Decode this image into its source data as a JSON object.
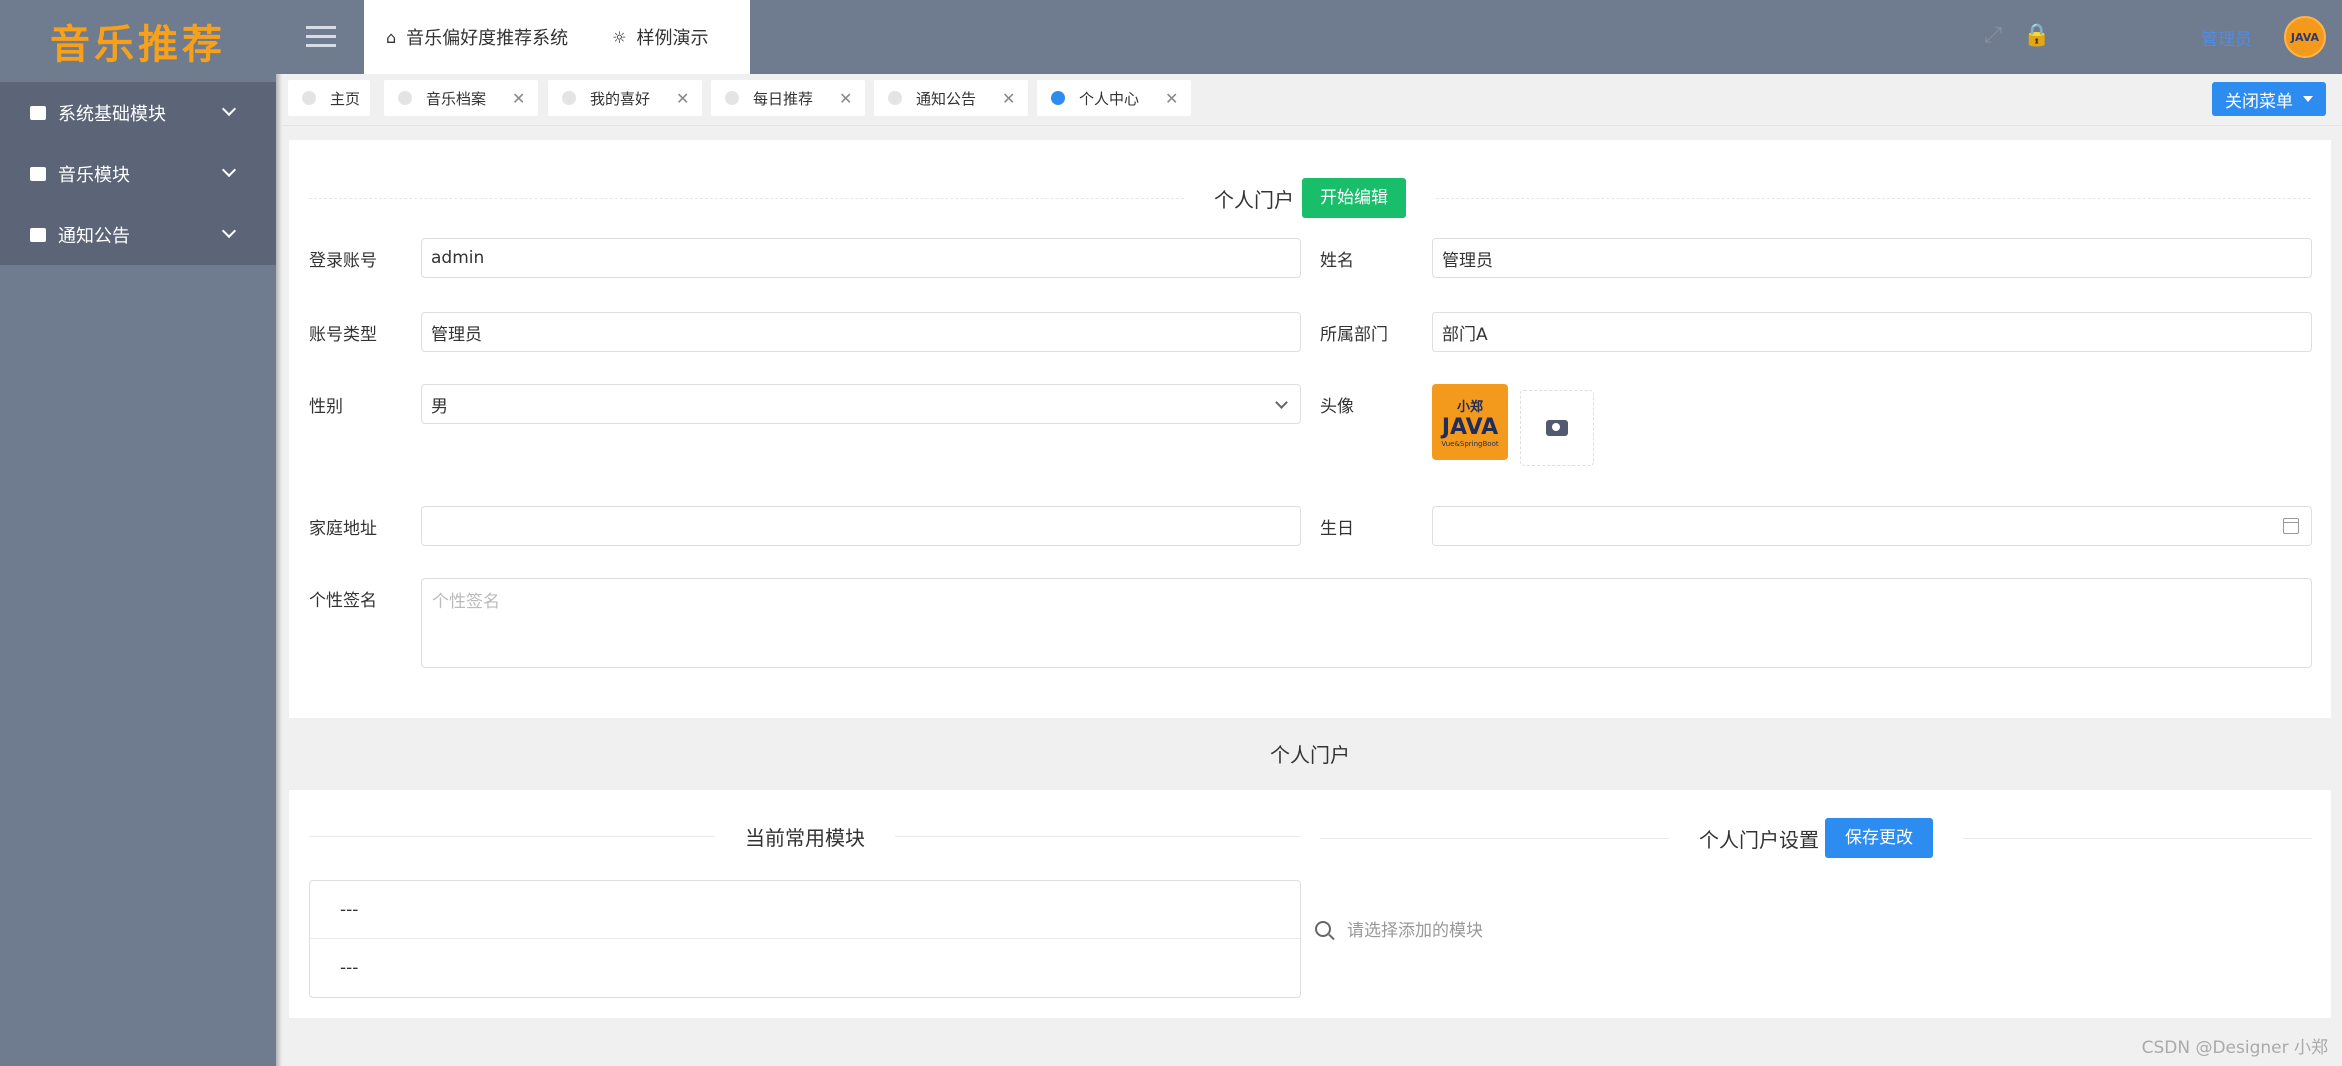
{
  "app": {
    "logo": "音乐推荐"
  },
  "sidebar": {
    "items": [
      {
        "label": "系统基础模块",
        "icon": "chart-icon"
      },
      {
        "label": "音乐模块",
        "icon": "cup-icon"
      },
      {
        "label": "通知公告",
        "icon": "notice-icon"
      }
    ]
  },
  "header": {
    "tabs": [
      {
        "label": "音乐偏好度推荐系统",
        "icon": "home-icon"
      },
      {
        "label": "样例演示",
        "icon": "bulb-icon"
      }
    ],
    "user_name": "管理员",
    "avatar_text": "JAVA"
  },
  "tabbar": {
    "tabs": [
      {
        "label": "主页",
        "active": false,
        "closable": false
      },
      {
        "label": "音乐档案",
        "active": false,
        "closable": true
      },
      {
        "label": "我的喜好",
        "active": false,
        "closable": true
      },
      {
        "label": "每日推荐",
        "active": false,
        "closable": true
      },
      {
        "label": "通知公告",
        "active": false,
        "closable": true
      },
      {
        "label": "个人中心",
        "active": true,
        "closable": true
      }
    ],
    "close_menu_label": "关闭菜单"
  },
  "profile": {
    "title": "个人门户",
    "edit_button": "开始编辑",
    "fields": {
      "login_account": {
        "label": "登录账号",
        "value": "admin"
      },
      "name": {
        "label": "姓名",
        "value": "管理员"
      },
      "account_type": {
        "label": "账号类型",
        "value": "管理员"
      },
      "department": {
        "label": "所属部门",
        "value": "部门A"
      },
      "gender": {
        "label": "性别",
        "value": "男"
      },
      "avatar": {
        "label": "头像",
        "img_line1": "小郑",
        "img_line2": "JAVA",
        "img_line3": "Vue&SpringBoot"
      },
      "address": {
        "label": "家庭地址",
        "value": ""
      },
      "birthday": {
        "label": "生日",
        "value": ""
      },
      "signature": {
        "label": "个性签名",
        "placeholder": "个性签名"
      }
    }
  },
  "portal": {
    "section_title": "个人门户",
    "current_modules_title": "当前常用模块",
    "modules": [
      "---",
      "---"
    ],
    "settings_title": "个人门户设置",
    "save_button": "保存更改",
    "search_placeholder": "请选择添加的模块"
  },
  "watermark": "CSDN @Designer 小郑"
}
